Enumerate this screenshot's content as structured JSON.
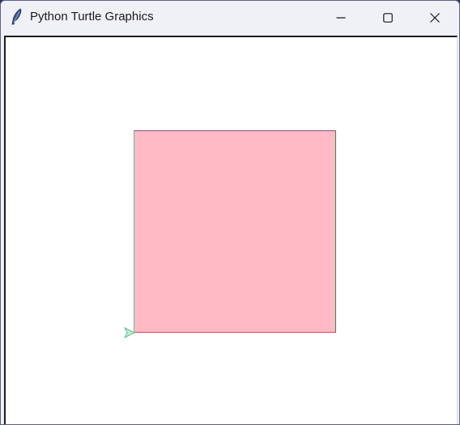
{
  "window": {
    "title": "Python Turtle Graphics",
    "app_icon": "feather-icon"
  },
  "titlebar_buttons": {
    "minimize_icon": "minimize-icon",
    "maximize_icon": "maximize-icon",
    "close_icon": "close-icon"
  },
  "drawing": {
    "shape": "square",
    "fill_color": "#ffbac6",
    "edge_colors": {
      "top": "#8a4a8a",
      "right": "#3a8a3a",
      "bottom": "#e04050",
      "left": "#60c0a0"
    },
    "turtle_color": "#7fcfa0",
    "turtle_icon": "turtle-arrow-icon"
  }
}
